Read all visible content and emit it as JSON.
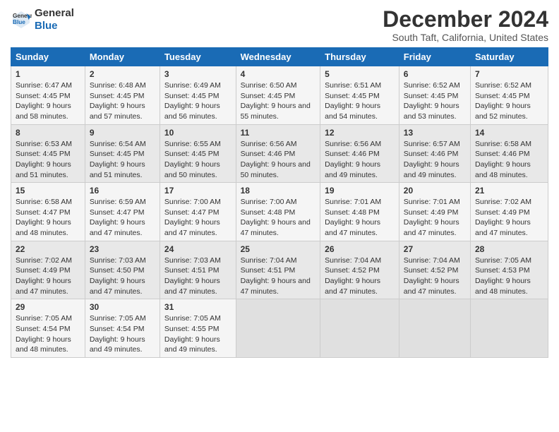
{
  "logo": {
    "line1": "General",
    "line2": "Blue"
  },
  "title": "December 2024",
  "subtitle": "South Taft, California, United States",
  "days_header": [
    "Sunday",
    "Monday",
    "Tuesday",
    "Wednesday",
    "Thursday",
    "Friday",
    "Saturday"
  ],
  "weeks": [
    [
      {
        "day": "1",
        "rise": "Sunrise: 6:47 AM",
        "set": "Sunset: 4:45 PM",
        "day_text": "Daylight: 9 hours and 58 minutes."
      },
      {
        "day": "2",
        "rise": "Sunrise: 6:48 AM",
        "set": "Sunset: 4:45 PM",
        "day_text": "Daylight: 9 hours and 57 minutes."
      },
      {
        "day": "3",
        "rise": "Sunrise: 6:49 AM",
        "set": "Sunset: 4:45 PM",
        "day_text": "Daylight: 9 hours and 56 minutes."
      },
      {
        "day": "4",
        "rise": "Sunrise: 6:50 AM",
        "set": "Sunset: 4:45 PM",
        "day_text": "Daylight: 9 hours and 55 minutes."
      },
      {
        "day": "5",
        "rise": "Sunrise: 6:51 AM",
        "set": "Sunset: 4:45 PM",
        "day_text": "Daylight: 9 hours and 54 minutes."
      },
      {
        "day": "6",
        "rise": "Sunrise: 6:52 AM",
        "set": "Sunset: 4:45 PM",
        "day_text": "Daylight: 9 hours and 53 minutes."
      },
      {
        "day": "7",
        "rise": "Sunrise: 6:52 AM",
        "set": "Sunset: 4:45 PM",
        "day_text": "Daylight: 9 hours and 52 minutes."
      }
    ],
    [
      {
        "day": "8",
        "rise": "Sunrise: 6:53 AM",
        "set": "Sunset: 4:45 PM",
        "day_text": "Daylight: 9 hours and 51 minutes."
      },
      {
        "day": "9",
        "rise": "Sunrise: 6:54 AM",
        "set": "Sunset: 4:45 PM",
        "day_text": "Daylight: 9 hours and 51 minutes."
      },
      {
        "day": "10",
        "rise": "Sunrise: 6:55 AM",
        "set": "Sunset: 4:45 PM",
        "day_text": "Daylight: 9 hours and 50 minutes."
      },
      {
        "day": "11",
        "rise": "Sunrise: 6:56 AM",
        "set": "Sunset: 4:46 PM",
        "day_text": "Daylight: 9 hours and 50 minutes."
      },
      {
        "day": "12",
        "rise": "Sunrise: 6:56 AM",
        "set": "Sunset: 4:46 PM",
        "day_text": "Daylight: 9 hours and 49 minutes."
      },
      {
        "day": "13",
        "rise": "Sunrise: 6:57 AM",
        "set": "Sunset: 4:46 PM",
        "day_text": "Daylight: 9 hours and 49 minutes."
      },
      {
        "day": "14",
        "rise": "Sunrise: 6:58 AM",
        "set": "Sunset: 4:46 PM",
        "day_text": "Daylight: 9 hours and 48 minutes."
      }
    ],
    [
      {
        "day": "15",
        "rise": "Sunrise: 6:58 AM",
        "set": "Sunset: 4:47 PM",
        "day_text": "Daylight: 9 hours and 48 minutes."
      },
      {
        "day": "16",
        "rise": "Sunrise: 6:59 AM",
        "set": "Sunset: 4:47 PM",
        "day_text": "Daylight: 9 hours and 47 minutes."
      },
      {
        "day": "17",
        "rise": "Sunrise: 7:00 AM",
        "set": "Sunset: 4:47 PM",
        "day_text": "Daylight: 9 hours and 47 minutes."
      },
      {
        "day": "18",
        "rise": "Sunrise: 7:00 AM",
        "set": "Sunset: 4:48 PM",
        "day_text": "Daylight: 9 hours and 47 minutes."
      },
      {
        "day": "19",
        "rise": "Sunrise: 7:01 AM",
        "set": "Sunset: 4:48 PM",
        "day_text": "Daylight: 9 hours and 47 minutes."
      },
      {
        "day": "20",
        "rise": "Sunrise: 7:01 AM",
        "set": "Sunset: 4:49 PM",
        "day_text": "Daylight: 9 hours and 47 minutes."
      },
      {
        "day": "21",
        "rise": "Sunrise: 7:02 AM",
        "set": "Sunset: 4:49 PM",
        "day_text": "Daylight: 9 hours and 47 minutes."
      }
    ],
    [
      {
        "day": "22",
        "rise": "Sunrise: 7:02 AM",
        "set": "Sunset: 4:49 PM",
        "day_text": "Daylight: 9 hours and 47 minutes."
      },
      {
        "day": "23",
        "rise": "Sunrise: 7:03 AM",
        "set": "Sunset: 4:50 PM",
        "day_text": "Daylight: 9 hours and 47 minutes."
      },
      {
        "day": "24",
        "rise": "Sunrise: 7:03 AM",
        "set": "Sunset: 4:51 PM",
        "day_text": "Daylight: 9 hours and 47 minutes."
      },
      {
        "day": "25",
        "rise": "Sunrise: 7:04 AM",
        "set": "Sunset: 4:51 PM",
        "day_text": "Daylight: 9 hours and 47 minutes."
      },
      {
        "day": "26",
        "rise": "Sunrise: 7:04 AM",
        "set": "Sunset: 4:52 PM",
        "day_text": "Daylight: 9 hours and 47 minutes."
      },
      {
        "day": "27",
        "rise": "Sunrise: 7:04 AM",
        "set": "Sunset: 4:52 PM",
        "day_text": "Daylight: 9 hours and 47 minutes."
      },
      {
        "day": "28",
        "rise": "Sunrise: 7:05 AM",
        "set": "Sunset: 4:53 PM",
        "day_text": "Daylight: 9 hours and 48 minutes."
      }
    ],
    [
      {
        "day": "29",
        "rise": "Sunrise: 7:05 AM",
        "set": "Sunset: 4:54 PM",
        "day_text": "Daylight: 9 hours and 48 minutes."
      },
      {
        "day": "30",
        "rise": "Sunrise: 7:05 AM",
        "set": "Sunset: 4:54 PM",
        "day_text": "Daylight: 9 hours and 49 minutes."
      },
      {
        "day": "31",
        "rise": "Sunrise: 7:05 AM",
        "set": "Sunset: 4:55 PM",
        "day_text": "Daylight: 9 hours and 49 minutes."
      },
      null,
      null,
      null,
      null
    ]
  ]
}
